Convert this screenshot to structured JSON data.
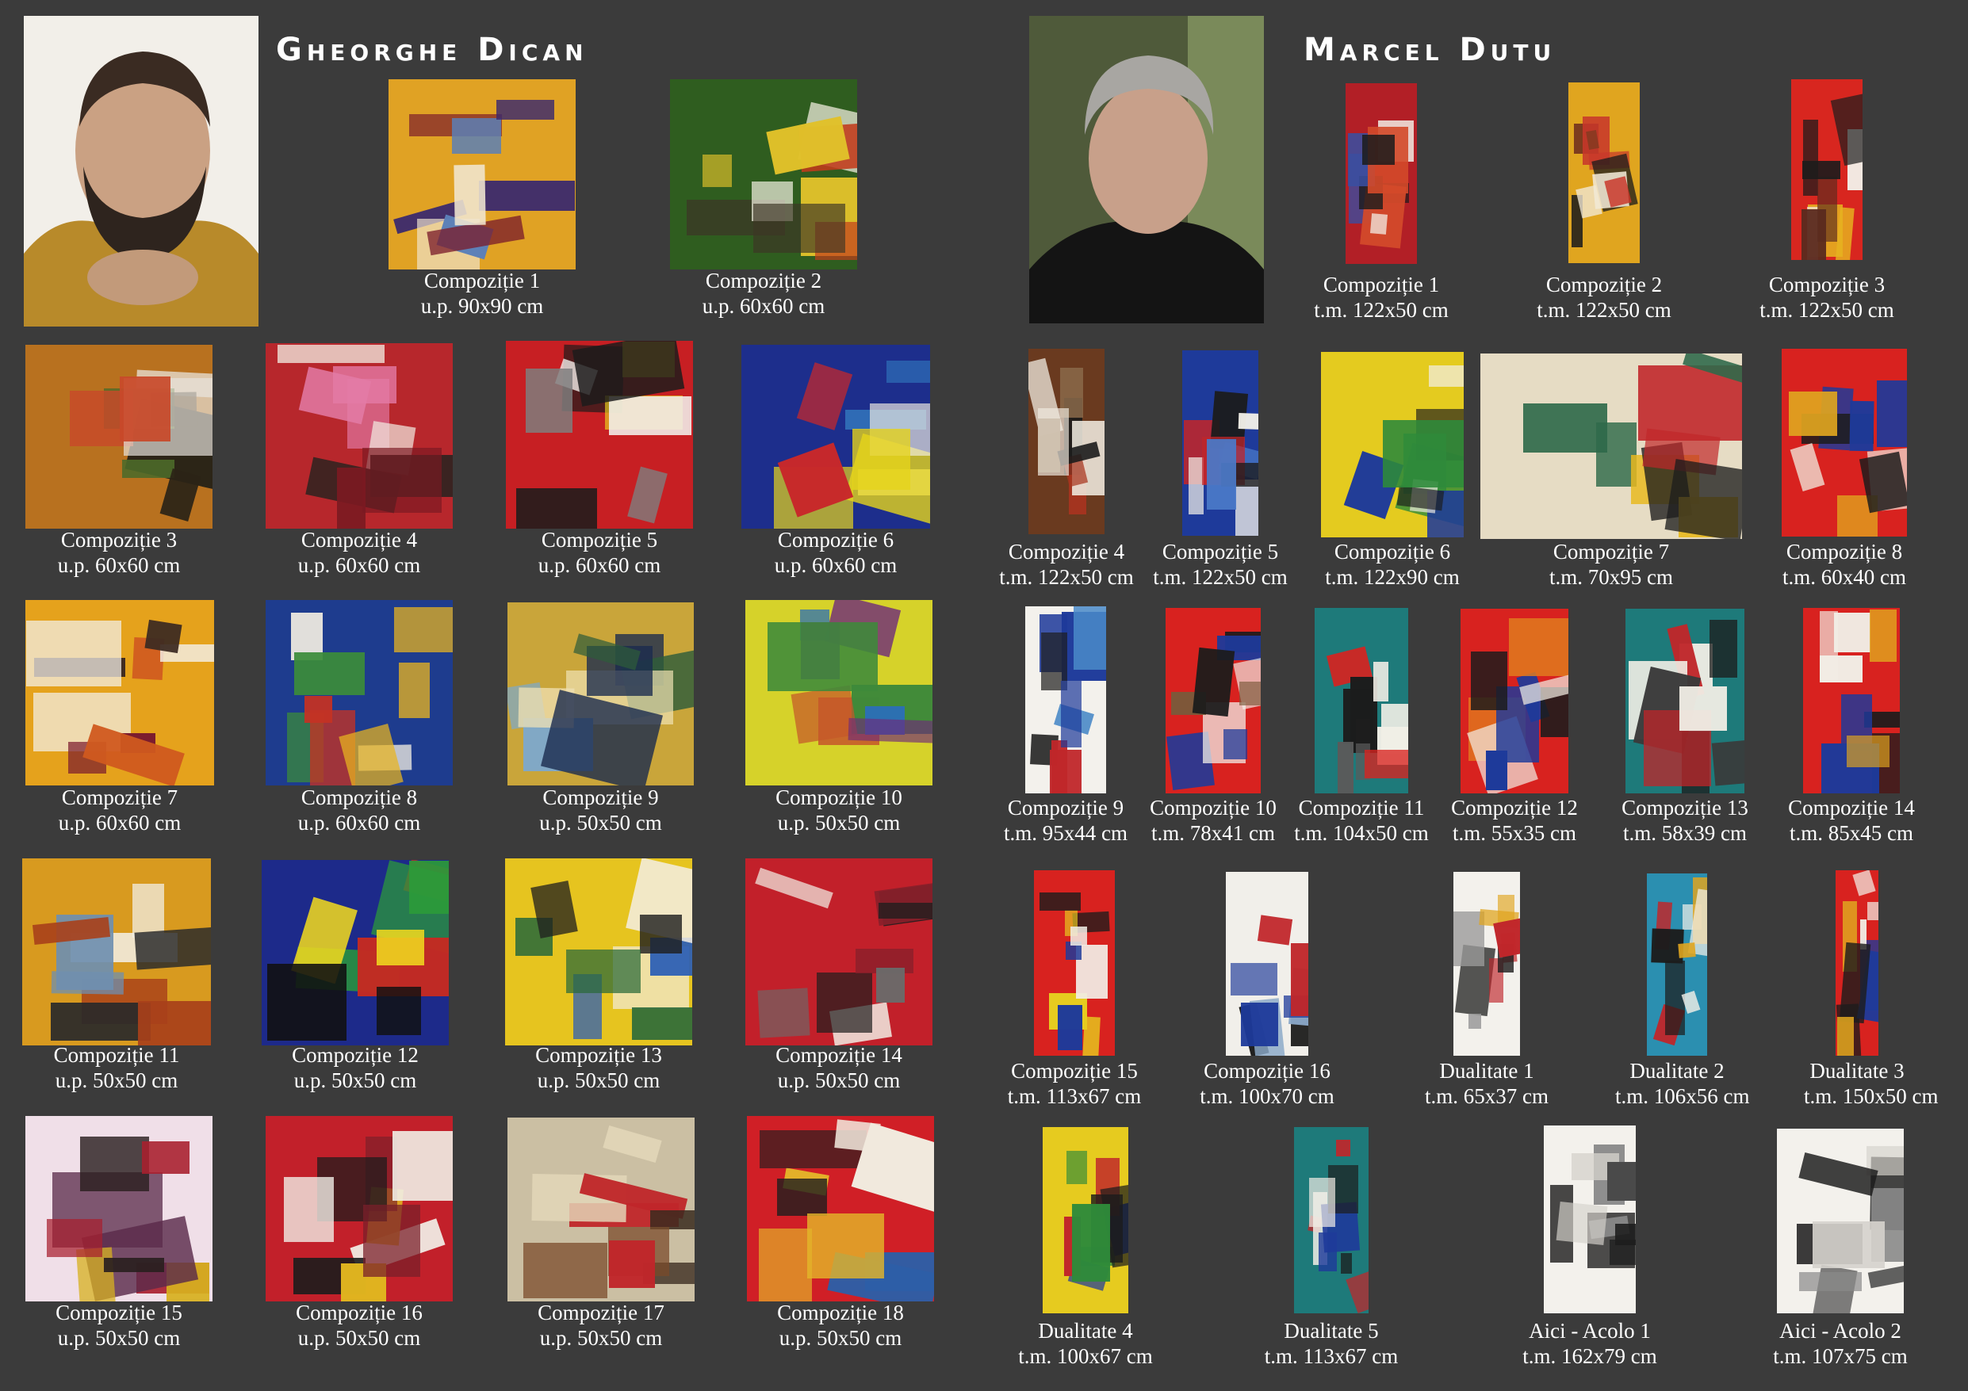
{
  "left": {
    "artist_name": "Gheorghe Dican",
    "artworks": [
      {
        "title": "Compoziție 1",
        "size": "u.p. 90x90 cm",
        "colors": [
          "#e0a224",
          "#3b2a6e",
          "#7a1c2b",
          "#f0e6d0",
          "#5b7fb8"
        ]
      },
      {
        "title": "Compoziție 2",
        "size": "u.p. 60x60 cm",
        "colors": [
          "#2f5d1f",
          "#e0c12a",
          "#c23b1b",
          "#f3efe0",
          "#3d3526"
        ]
      },
      {
        "title": "Compoziție 3",
        "size": "u.p. 60x60 cm",
        "colors": [
          "#b8711f",
          "#2b2417",
          "#e8e4dc",
          "#4e6b2a",
          "#c8492a"
        ]
      },
      {
        "title": "Compoziție 4",
        "size": "u.p. 60x60 cm",
        "colors": [
          "#b7272c",
          "#e37ba6",
          "#f2ece2",
          "#2d2320",
          "#7b1a22"
        ]
      },
      {
        "title": "Compoziție 5",
        "size": "u.p. 60x60 cm",
        "colors": [
          "#c71f23",
          "#1c1c1c",
          "#f2f0ec",
          "#7e7e7e",
          "#e9d31f"
        ]
      },
      {
        "title": "Compoziție 6",
        "size": "u.p. 60x60 cm",
        "colors": [
          "#1d2e8c",
          "#e6d41b",
          "#c7282a",
          "#2f6db7",
          "#f1ede3"
        ]
      },
      {
        "title": "Compoziție 7",
        "size": "u.p. 60x60 cm",
        "colors": [
          "#e5a21c",
          "#f3efe7",
          "#7c1c2e",
          "#3d2a22",
          "#d05a1f"
        ]
      },
      {
        "title": "Compoziție 8",
        "size": "u.p. 60x60 cm",
        "colors": [
          "#1e3c8e",
          "#e8b41f",
          "#3b8c3a",
          "#f0ece1",
          "#c43224"
        ]
      },
      {
        "title": "Compoziție 9",
        "size": "u.p. 50x50 cm",
        "colors": [
          "#c9a53a",
          "#1a2a4e",
          "#7fa8c8",
          "#2e5c3a",
          "#f0e2b4"
        ]
      },
      {
        "title": "Compoziție 10",
        "size": "u.p. 50x50 cm",
        "colors": [
          "#d6d22a",
          "#6e2a7a",
          "#2b6fb5",
          "#c5582a",
          "#3e8a3a"
        ]
      },
      {
        "title": "Compoziție 11",
        "size": "u.p. 50x50 cm",
        "colors": [
          "#d89a1f",
          "#a8401a",
          "#f2efe7",
          "#2a2a2a",
          "#6f8fb0"
        ]
      },
      {
        "title": "Compoziție 12",
        "size": "u.p. 50x50 cm",
        "colors": [
          "#1d2a8a",
          "#2b9a3a",
          "#c42a22",
          "#f0d81f",
          "#111111"
        ]
      },
      {
        "title": "Compoziție 13",
        "size": "u.p. 50x50 cm",
        "colors": [
          "#e6c41f",
          "#2a6a3a",
          "#2d5fb5",
          "#f3eee2",
          "#1f1f1f"
        ]
      },
      {
        "title": "Compoziție 14",
        "size": "u.p. 50x50 cm",
        "colors": [
          "#c2202a",
          "#1e1e1e",
          "#f1ece3",
          "#8a1f2a",
          "#6a6a6a"
        ]
      },
      {
        "title": "Compoziție 15",
        "size": "u.p. 50x50 cm",
        "colors": [
          "#f0dfe8",
          "#a81f2e",
          "#5a2a4a",
          "#d7b01f",
          "#2a1f1f"
        ]
      },
      {
        "title": "Compoziție 16",
        "size": "u.p. 50x50 cm",
        "colors": [
          "#c2202a",
          "#f1eee6",
          "#1c1c1c",
          "#e0b41f",
          "#7a1f2a"
        ]
      },
      {
        "title": "Compoziție 17",
        "size": "u.p. 50x50 cm",
        "colors": [
          "#cbbfa3",
          "#c0262a",
          "#3a2a1f",
          "#e3d7b8",
          "#7a4a2a"
        ]
      },
      {
        "title": "Compoziție 18",
        "size": "u.p. 50x50 cm",
        "colors": [
          "#d01f26",
          "#e3b42a",
          "#2d5fa8",
          "#1e1e1e",
          "#f1e9dd"
        ]
      }
    ]
  },
  "right": {
    "artist_name": "Marcel Dutu",
    "artworks": [
      {
        "title": "Compoziție 1",
        "size": "t.m. 122x50 cm",
        "colors": [
          "#b21f26",
          "#1c1c1c",
          "#f1ece4",
          "#3a4ea0",
          "#d34a2a"
        ]
      },
      {
        "title": "Compoziție 2",
        "size": "t.m. 122x50 cm",
        "colors": [
          "#e0a51f",
          "#c8372a",
          "#1c1c1c",
          "#f1e8d5",
          "#7a3a1f"
        ]
      },
      {
        "title": "Compoziție 3",
        "size": "t.m. 122x50 cm",
        "colors": [
          "#d8261f",
          "#1c1c1c",
          "#e6b21f",
          "#f2efe8",
          "#5a2a1f"
        ]
      },
      {
        "title": "Compoziție 4",
        "size": "t.m. 122x50 cm",
        "colors": [
          "#6a3a1f",
          "#f0ebe0",
          "#a8341f",
          "#1c1c1c",
          "#8a6a4a"
        ]
      },
      {
        "title": "Compoziție 5",
        "size": "t.m. 122x50 cm",
        "colors": [
          "#1e3a9a",
          "#f1efe8",
          "#c0262a",
          "#1c1c1c",
          "#4a7ac8"
        ]
      },
      {
        "title": "Compoziție 6",
        "size": "t.m. 122x90 cm",
        "colors": [
          "#e4cb1f",
          "#2e8a3a",
          "#1e3a9a",
          "#f1ede3",
          "#1c1c1c"
        ]
      },
      {
        "title": "Compoziție 7",
        "size": "t.m. 70x95 cm",
        "colors": [
          "#e6dcc4",
          "#2e6a4a",
          "#c0262a",
          "#e8b91f",
          "#1c1c1c"
        ]
      },
      {
        "title": "Compoziție 8",
        "size": "t.m. 60x40 cm",
        "colors": [
          "#d8221f",
          "#1e3a9a",
          "#f2ece0",
          "#e0a51f",
          "#1c1c1c"
        ]
      },
      {
        "title": "Compoziție 9",
        "size": "t.m. 95x44 cm",
        "colors": [
          "#f3f1ec",
          "#1e3a9a",
          "#4a8ac8",
          "#1c1c1c",
          "#c0262a"
        ]
      },
      {
        "title": "Compoziție 10",
        "size": "t.m. 78x41 cm",
        "colors": [
          "#d8221f",
          "#1e3a9a",
          "#f2efe8",
          "#1c1c1c",
          "#7a5a3a"
        ]
      },
      {
        "title": "Compoziție 11",
        "size": "t.m. 104x50 cm",
        "colors": [
          "#1e7a7a",
          "#f1eee6",
          "#d8221f",
          "#1c1c1c",
          "#5a5a5a"
        ]
      },
      {
        "title": "Compoziție 12",
        "size": "t.m. 55x35 cm",
        "colors": [
          "#d8221f",
          "#1e3a9a",
          "#e07a1f",
          "#f2ece2",
          "#1c1c1c"
        ]
      },
      {
        "title": "Compoziție 13",
        "size": "t.m. 58x39 cm",
        "colors": [
          "#1e7a7a",
          "#f1eee6",
          "#3a3a3a",
          "#1c1c1c",
          "#c0262a"
        ]
      },
      {
        "title": "Compoziție 14",
        "size": "t.m. 85x45 cm",
        "colors": [
          "#d8221f",
          "#f1ede5",
          "#1c1c1c",
          "#1e3a9a",
          "#e0a51f"
        ]
      },
      {
        "title": "Compoziție 15",
        "size": "t.m. 113x67 cm",
        "colors": [
          "#d8221f",
          "#e6cb1f",
          "#f1ede5",
          "#1c1c1c",
          "#1e3a9a"
        ]
      },
      {
        "title": "Compoziție 16",
        "size": "t.m. 100x70 cm",
        "colors": [
          "#f1efea",
          "#1e3a9a",
          "#c0262a",
          "#1c1c1c",
          "#8aa8c8"
        ]
      },
      {
        "title": "Dualitate 1",
        "size": "t.m. 65x37 cm",
        "colors": [
          "#f3f1ec",
          "#c0262a",
          "#1c1c1c",
          "#9a9a9a",
          "#e0a51f"
        ]
      },
      {
        "title": "Dualitate 2",
        "size": "t.m. 106x56 cm",
        "colors": [
          "#2b8fb0",
          "#f1efe8",
          "#c0262a",
          "#1c1c1c",
          "#e0a51f"
        ]
      },
      {
        "title": "Dualitate 3",
        "size": "t.m. 150x50 cm",
        "colors": [
          "#d8221f",
          "#f1ede5",
          "#1e3a9a",
          "#1c1c1c",
          "#e0a51f"
        ]
      },
      {
        "title": "Dualitate 4",
        "size": "t.m. 100x67 cm",
        "colors": [
          "#e6cb1f",
          "#2e8a3a",
          "#1e3a9a",
          "#c0262a",
          "#1c1c1c"
        ]
      },
      {
        "title": "Dualitate 5",
        "size": "t.m. 113x67 cm",
        "colors": [
          "#1e7a7a",
          "#c0262a",
          "#f1ede5",
          "#1e3a9a",
          "#1c1c1c"
        ]
      },
      {
        "title": "Aici - Acolo 1",
        "size": "t.m. 162x79 cm",
        "colors": [
          "#f3f1ec",
          "#1c1c1c",
          "#8a8a8a",
          "#d5d2cc",
          "#4a4a4a"
        ]
      },
      {
        "title": "Aici - Acolo 2",
        "size": "t.m. 107x75 cm",
        "colors": [
          "#f3f1ec",
          "#1c1c1c",
          "#8a8a8a",
          "#d5d2cc",
          "#4a4a4a"
        ]
      }
    ]
  }
}
